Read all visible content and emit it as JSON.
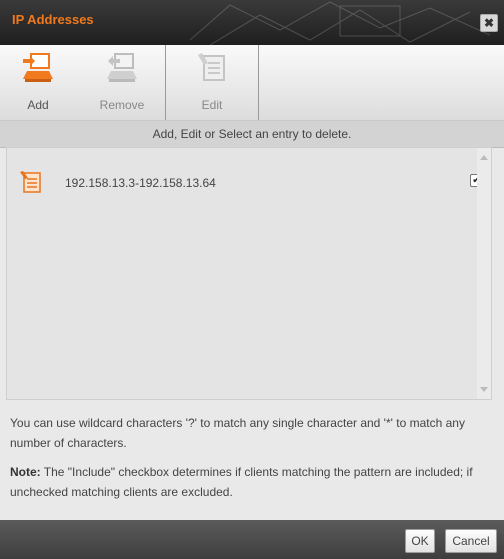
{
  "window": {
    "title": "IP Addresses",
    "close_glyph": "✖"
  },
  "toolbar": {
    "add_label": "Add",
    "remove_label": "Remove",
    "edit_label": "Edit"
  },
  "hint": "Add, Edit or Select an entry to delete.",
  "entries": [
    {
      "value": "192.158.13.3-192.158.13.64",
      "checked": true,
      "check_glyph": "✔"
    }
  ],
  "info": {
    "wildcard_text": "You can use wildcard characters '?' to match any single character and '*' to match any number of characters.",
    "note_label": "Note:",
    "note_text": " The \"Include\" checkbox determines if clients matching the pattern are included; if unchecked matching clients are excluded."
  },
  "footer": {
    "ok_label": "OK",
    "cancel_label": "Cancel"
  },
  "colors": {
    "accent": "#f07a1d",
    "titlebar": "#2a2a2a",
    "footer": "#4a4a4a"
  }
}
